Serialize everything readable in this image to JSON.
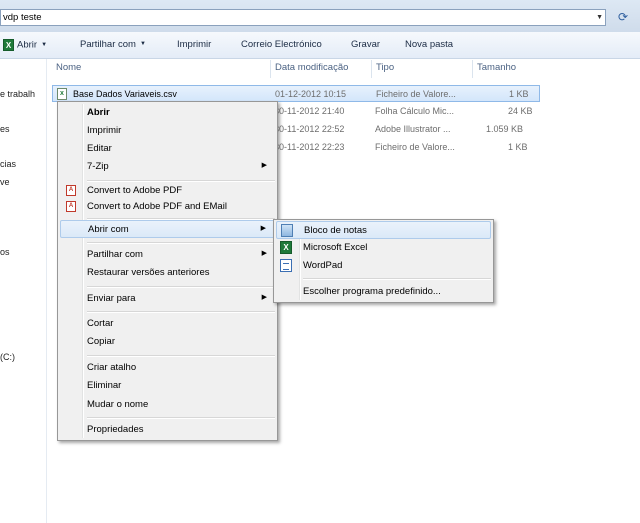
{
  "address": {
    "path": "vdp teste"
  },
  "toolbar": {
    "open_label": "Abrir",
    "share_label": "Partilhar com",
    "print_label": "Imprimir",
    "email_label": "Correio Electrónico",
    "burn_label": "Gravar",
    "new_folder_label": "Nova pasta"
  },
  "nav": {
    "items": [
      "e trabalh",
      "es",
      "cias",
      "ve",
      "os",
      "(C:)"
    ]
  },
  "columns": {
    "name": "Nome",
    "modified": "Data modificação",
    "type": "Tipo",
    "size": "Tamanho"
  },
  "files": [
    {
      "name": "Base Dados Variaveis.csv",
      "date": "01-12-2012 10:15",
      "type": "Ficheiro de Valore...",
      "size": "1 KB"
    },
    {
      "name": "",
      "date": "30-11-2012 21:40",
      "type": "Folha Cálculo Mic...",
      "size": "24 KB"
    },
    {
      "name": "",
      "date": "30-11-2012 22:52",
      "type": "Adobe Illustrator ...",
      "size": "1.059 KB"
    },
    {
      "name": "",
      "date": "30-11-2012 22:23",
      "type": "Ficheiro de Valore...",
      "size": "1 KB"
    }
  ],
  "context_menu": {
    "open": "Abrir",
    "print": "Imprimir",
    "edit": "Editar",
    "zip": "7-Zip",
    "convert_pdf": "Convert to Adobe PDF",
    "convert_pdf_email": "Convert to Adobe PDF and EMail",
    "open_with": "Abrir com",
    "share_with": "Partilhar com",
    "restore": "Restaurar versões anteriores",
    "send_to": "Enviar para",
    "cut": "Cortar",
    "copy": "Copiar",
    "create_shortcut": "Criar atalho",
    "delete": "Eliminar",
    "rename": "Mudar o nome",
    "properties": "Propriedades"
  },
  "open_with_menu": {
    "notepad": "Bloco de notas",
    "excel": "Microsoft Excel",
    "wordpad": "WordPad",
    "choose_default": "Escolher programa predefinido..."
  }
}
